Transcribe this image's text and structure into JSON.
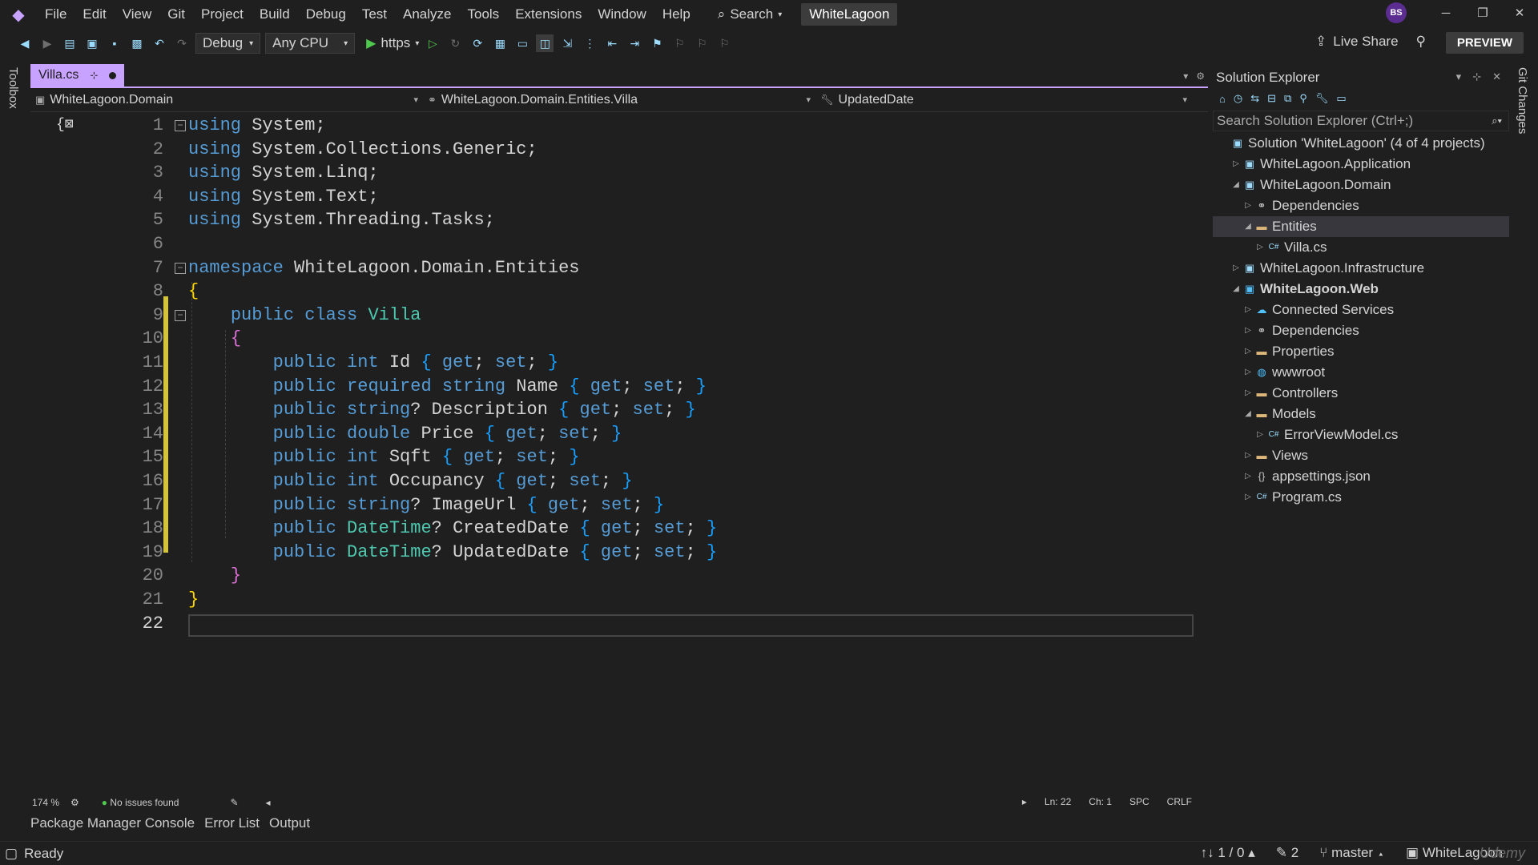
{
  "menubar": {
    "items": [
      "File",
      "Edit",
      "View",
      "Git",
      "Project",
      "Build",
      "Debug",
      "Test",
      "Analyze",
      "Tools",
      "Extensions",
      "Window",
      "Help"
    ],
    "search_label": "Search",
    "solution_title": "WhiteLagoon",
    "user_initials": "BS"
  },
  "toolbar": {
    "config": "Debug",
    "platform": "Any CPU",
    "run_target": "https",
    "live_share": "Live Share",
    "preview": "PREVIEW"
  },
  "left_strip": {
    "label": "Toolbox"
  },
  "right_strip": {
    "label": "Git Changes"
  },
  "editor": {
    "tab_title": "Villa.cs",
    "nav_project": "WhiteLagoon.Domain",
    "nav_type": "WhiteLagoon.Domain.Entities.Villa",
    "nav_member": "UpdatedDate",
    "current_line": 22,
    "lines": [
      {
        "n": "1"
      },
      {
        "n": "2"
      },
      {
        "n": "3"
      },
      {
        "n": "4"
      },
      {
        "n": "5"
      },
      {
        "n": "6"
      },
      {
        "n": "7"
      },
      {
        "n": "8"
      },
      {
        "n": "9"
      },
      {
        "n": "10"
      },
      {
        "n": "11"
      },
      {
        "n": "12"
      },
      {
        "n": "13"
      },
      {
        "n": "14"
      },
      {
        "n": "15"
      },
      {
        "n": "16"
      },
      {
        "n": "17"
      },
      {
        "n": "18"
      },
      {
        "n": "19"
      },
      {
        "n": "20"
      },
      {
        "n": "21"
      },
      {
        "n": "22"
      }
    ],
    "code": [
      [
        [
          "kw",
          "using"
        ],
        [
          "pl",
          " System;"
        ]
      ],
      [
        [
          "kw",
          "using"
        ],
        [
          "pl",
          " System.Collections.Generic;"
        ]
      ],
      [
        [
          "kw",
          "using"
        ],
        [
          "pl",
          " System.Linq;"
        ]
      ],
      [
        [
          "kw",
          "using"
        ],
        [
          "pl",
          " System.Text;"
        ]
      ],
      [
        [
          "kw",
          "using"
        ],
        [
          "pl",
          " System.Threading.Tasks;"
        ]
      ],
      [],
      [
        [
          "kw",
          "namespace"
        ],
        [
          "pl",
          " WhiteLagoon.Domain.Entities"
        ]
      ],
      [
        [
          "br1",
          "{"
        ]
      ],
      [
        [
          "pl",
          "    "
        ],
        [
          "kw",
          "public"
        ],
        [
          "pl",
          " "
        ],
        [
          "kw",
          "class"
        ],
        [
          "pl",
          " "
        ],
        [
          "ty",
          "Villa"
        ]
      ],
      [
        [
          "pl",
          "    "
        ],
        [
          "br2",
          "{"
        ]
      ],
      [
        [
          "pl",
          "        "
        ],
        [
          "kw",
          "public"
        ],
        [
          "pl",
          " "
        ],
        [
          "kw",
          "int"
        ],
        [
          "pl",
          " Id "
        ],
        [
          "br3",
          "{"
        ],
        [
          "pl",
          " "
        ],
        [
          "kw",
          "get"
        ],
        [
          "pl",
          "; "
        ],
        [
          "kw",
          "set"
        ],
        [
          "pl",
          "; "
        ],
        [
          "br3",
          "}"
        ]
      ],
      [
        [
          "pl",
          "        "
        ],
        [
          "kw",
          "public"
        ],
        [
          "pl",
          " "
        ],
        [
          "kw",
          "required"
        ],
        [
          "pl",
          " "
        ],
        [
          "kw",
          "string"
        ],
        [
          "pl",
          " Name "
        ],
        [
          "br3",
          "{"
        ],
        [
          "pl",
          " "
        ],
        [
          "kw",
          "get"
        ],
        [
          "pl",
          "; "
        ],
        [
          "kw",
          "set"
        ],
        [
          "pl",
          "; "
        ],
        [
          "br3",
          "}"
        ]
      ],
      [
        [
          "pl",
          "        "
        ],
        [
          "kw",
          "public"
        ],
        [
          "pl",
          " "
        ],
        [
          "kw",
          "string"
        ],
        [
          "pl",
          "? Description "
        ],
        [
          "br3",
          "{"
        ],
        [
          "pl",
          " "
        ],
        [
          "kw",
          "get"
        ],
        [
          "pl",
          "; "
        ],
        [
          "kw",
          "set"
        ],
        [
          "pl",
          "; "
        ],
        [
          "br3",
          "}"
        ]
      ],
      [
        [
          "pl",
          "        "
        ],
        [
          "kw",
          "public"
        ],
        [
          "pl",
          " "
        ],
        [
          "kw",
          "double"
        ],
        [
          "pl",
          " Price "
        ],
        [
          "br3",
          "{"
        ],
        [
          "pl",
          " "
        ],
        [
          "kw",
          "get"
        ],
        [
          "pl",
          "; "
        ],
        [
          "kw",
          "set"
        ],
        [
          "pl",
          "; "
        ],
        [
          "br3",
          "}"
        ]
      ],
      [
        [
          "pl",
          "        "
        ],
        [
          "kw",
          "public"
        ],
        [
          "pl",
          " "
        ],
        [
          "kw",
          "int"
        ],
        [
          "pl",
          " Sqft "
        ],
        [
          "br3",
          "{"
        ],
        [
          "pl",
          " "
        ],
        [
          "kw",
          "get"
        ],
        [
          "pl",
          "; "
        ],
        [
          "kw",
          "set"
        ],
        [
          "pl",
          "; "
        ],
        [
          "br3",
          "}"
        ]
      ],
      [
        [
          "pl",
          "        "
        ],
        [
          "kw",
          "public"
        ],
        [
          "pl",
          " "
        ],
        [
          "kw",
          "int"
        ],
        [
          "pl",
          " Occupancy "
        ],
        [
          "br3",
          "{"
        ],
        [
          "pl",
          " "
        ],
        [
          "kw",
          "get"
        ],
        [
          "pl",
          "; "
        ],
        [
          "kw",
          "set"
        ],
        [
          "pl",
          "; "
        ],
        [
          "br3",
          "}"
        ]
      ],
      [
        [
          "pl",
          "        "
        ],
        [
          "kw",
          "public"
        ],
        [
          "pl",
          " "
        ],
        [
          "kw",
          "string"
        ],
        [
          "pl",
          "? ImageUrl "
        ],
        [
          "br3",
          "{"
        ],
        [
          "pl",
          " "
        ],
        [
          "kw",
          "get"
        ],
        [
          "pl",
          "; "
        ],
        [
          "kw",
          "set"
        ],
        [
          "pl",
          "; "
        ],
        [
          "br3",
          "}"
        ]
      ],
      [
        [
          "pl",
          "        "
        ],
        [
          "kw",
          "public"
        ],
        [
          "pl",
          " "
        ],
        [
          "ty",
          "DateTime"
        ],
        [
          "pl",
          "? CreatedDate "
        ],
        [
          "br3",
          "{"
        ],
        [
          "pl",
          " "
        ],
        [
          "kw",
          "get"
        ],
        [
          "pl",
          "; "
        ],
        [
          "kw",
          "set"
        ],
        [
          "pl",
          "; "
        ],
        [
          "br3",
          "}"
        ]
      ],
      [
        [
          "pl",
          "        "
        ],
        [
          "kw",
          "public"
        ],
        [
          "pl",
          " "
        ],
        [
          "ty",
          "DateTime"
        ],
        [
          "pl",
          "? UpdatedDate "
        ],
        [
          "br3",
          "{"
        ],
        [
          "pl",
          " "
        ],
        [
          "kw",
          "get"
        ],
        [
          "pl",
          "; "
        ],
        [
          "kw",
          "set"
        ],
        [
          "pl",
          "; "
        ],
        [
          "br3",
          "}"
        ]
      ],
      [
        [
          "pl",
          "    "
        ],
        [
          "br2",
          "}"
        ]
      ],
      [
        [
          "br1",
          "}"
        ]
      ],
      []
    ],
    "status": {
      "zoom": "174 %",
      "issues": "No issues found",
      "ln": "Ln: 22",
      "ch": "Ch: 1",
      "spc": "SPC",
      "eol": "CRLF"
    }
  },
  "solution_explorer": {
    "title": "Solution Explorer",
    "search_placeholder": "Search Solution Explorer (Ctrl+;)",
    "items": [
      {
        "label": "Solution 'WhiteLagoon' (4 of 4 projects)",
        "level": 0,
        "icon": "solution-icon",
        "exp": ""
      },
      {
        "label": "WhiteLagoon.Application",
        "level": 1,
        "icon": "project-icon",
        "exp": "▷"
      },
      {
        "label": "WhiteLagoon.Domain",
        "level": 1,
        "icon": "project-icon",
        "exp": "◢"
      },
      {
        "label": "Dependencies",
        "level": 2,
        "icon": "dependencies-icon",
        "exp": "▷"
      },
      {
        "label": "Entities",
        "level": 2,
        "icon": "folder-icon",
        "exp": "◢",
        "selected": true
      },
      {
        "label": "Villa.cs",
        "level": 3,
        "icon": "csharp-file-icon",
        "exp": "▷"
      },
      {
        "label": "WhiteLagoon.Infrastructure",
        "level": 1,
        "icon": "project-icon",
        "exp": "▷"
      },
      {
        "label": "WhiteLagoon.Web",
        "level": 1,
        "icon": "web-project-icon",
        "exp": "◢",
        "bold": true
      },
      {
        "label": "Connected Services",
        "level": 2,
        "icon": "connected-services-icon",
        "exp": "▷"
      },
      {
        "label": "Dependencies",
        "level": 2,
        "icon": "dependencies-icon",
        "exp": "▷"
      },
      {
        "label": "Properties",
        "level": 2,
        "icon": "properties-icon",
        "exp": "▷"
      },
      {
        "label": "wwwroot",
        "level": 2,
        "icon": "globe-icon",
        "exp": "▷"
      },
      {
        "label": "Controllers",
        "level": 2,
        "icon": "folder-icon",
        "exp": "▷"
      },
      {
        "label": "Models",
        "level": 2,
        "icon": "folder-icon",
        "exp": "◢"
      },
      {
        "label": "ErrorViewModel.cs",
        "level": 3,
        "icon": "csharp-file-icon",
        "exp": "▷"
      },
      {
        "label": "Views",
        "level": 2,
        "icon": "folder-icon",
        "exp": "▷"
      },
      {
        "label": "appsettings.json",
        "level": 2,
        "icon": "json-file-icon",
        "exp": "▷"
      },
      {
        "label": "Program.cs",
        "level": 2,
        "icon": "csharp-file-icon",
        "exp": "▷"
      }
    ]
  },
  "bottom_tabs": [
    "Package Manager Console",
    "Error List",
    "Output"
  ],
  "statusbar": {
    "ready": "Ready",
    "sync": "↑↓ 1 / 0",
    "edits": "2",
    "branch": "master",
    "repo": "WhiteLagoon"
  },
  "watermark": "Udemy",
  "colors": {
    "accent": "#c8a2ff",
    "keyword": "#569cd6",
    "type": "#4ec9b0",
    "text": "#d4d4d4",
    "background": "#1f1f1f"
  }
}
